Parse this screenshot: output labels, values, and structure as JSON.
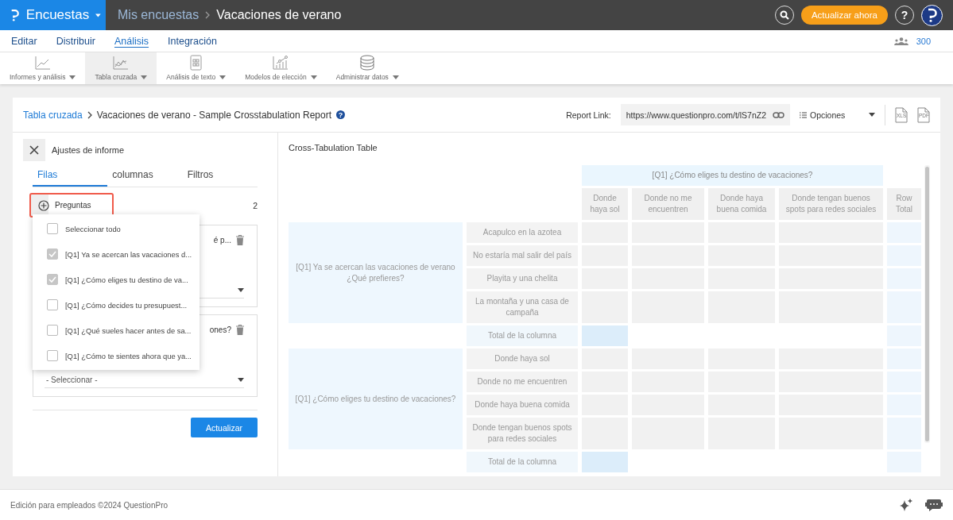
{
  "app": {
    "name": "Encuestas"
  },
  "breadcrumb": [
    "Mis encuestas",
    "Vacaciones de verano"
  ],
  "upgrade_button": "Actualizar ahora",
  "help_button": "?",
  "nav_tabs": [
    {
      "label": "Editar",
      "selected": false
    },
    {
      "label": "Distribuir",
      "selected": false
    },
    {
      "label": "Análisis",
      "selected": true
    },
    {
      "label": "Integración",
      "selected": false
    }
  ],
  "responses_count": "300",
  "toolbar": [
    {
      "label": "Informes y análisis",
      "kind": "line-chart",
      "selected": false
    },
    {
      "label": "Tabla cruzada",
      "kind": "crosstab",
      "selected": true
    },
    {
      "label": "Análisis de texto",
      "kind": "text-grid",
      "selected": false
    },
    {
      "label": "Modelos de elección",
      "kind": "scatter",
      "selected": false
    },
    {
      "label": "Administrar datos",
      "kind": "database",
      "selected": false
    }
  ],
  "report": {
    "breadcrumb_link": "Tabla cruzada",
    "title": "Vacaciones de verano - Sample Crosstabulation Report",
    "title_help": "?",
    "link_label": "Report Link:",
    "link_value": "https://www.questionpro.com/t/lS7nZ2",
    "options": "Opciones",
    "exports": [
      "XLS",
      "PDF"
    ]
  },
  "settings": {
    "title": "Ajustes de informe",
    "tabs": [
      {
        "label": "Filas",
        "selected": true
      },
      {
        "label": "columnas",
        "selected": false
      },
      {
        "label": "Filtros",
        "selected": false
      }
    ],
    "add_button": "Preguntas",
    "count": "2",
    "cards": [
      {
        "question": "é p..."
      },
      {
        "question": "ones?",
        "select": "- Seleccionar -"
      }
    ],
    "menu": [
      {
        "label": "Seleccionar todo",
        "checked": false
      },
      {
        "label": "[Q1] Ya se acercan las vacaciones d...",
        "checked": true
      },
      {
        "label": "[Q1] ¿Cómo eliges tu destino de va...",
        "checked": true
      },
      {
        "label": "[Q1] ¿Cómo decides tu presupuest...",
        "checked": false
      },
      {
        "label": "[Q1] ¿Qué sueles hacer antes de sa...",
        "checked": false
      },
      {
        "label": "[Q1] ¿Cómo te sientes ahora que ya...",
        "checked": false
      }
    ],
    "submit": "Actualizar"
  },
  "table": {
    "title": "Cross-Tabulation Table",
    "column_question": "[Q1] ¿Cómo eliges tu destino de vacaciones?",
    "columns": [
      "Donde haya sol",
      "Donde no me encuentren",
      "Donde haya buena comida",
      "Donde tengan buenos spots para redes sociales",
      "Row Total"
    ],
    "groups": [
      {
        "question": "[Q1] Ya se acercan las vacaciones de verano ¿Qué prefieres?",
        "answers": [
          "Acapulco en la azotea",
          "No estaría mal salir del país",
          "Playita y una chelita",
          "La montaña y una casa de campaña"
        ],
        "total": "Total de la columna"
      },
      {
        "question": "[Q1] ¿Cómo eliges tu destino de vacaciones?",
        "answers": [
          "Donde haya sol",
          "Donde no me encuentren",
          "Donde haya buena comida",
          "Donde tengan buenos spots para redes sociales"
        ],
        "total": "Total de la columna"
      }
    ]
  },
  "footer": "Edición para empleados ©2024 QuestionPro"
}
